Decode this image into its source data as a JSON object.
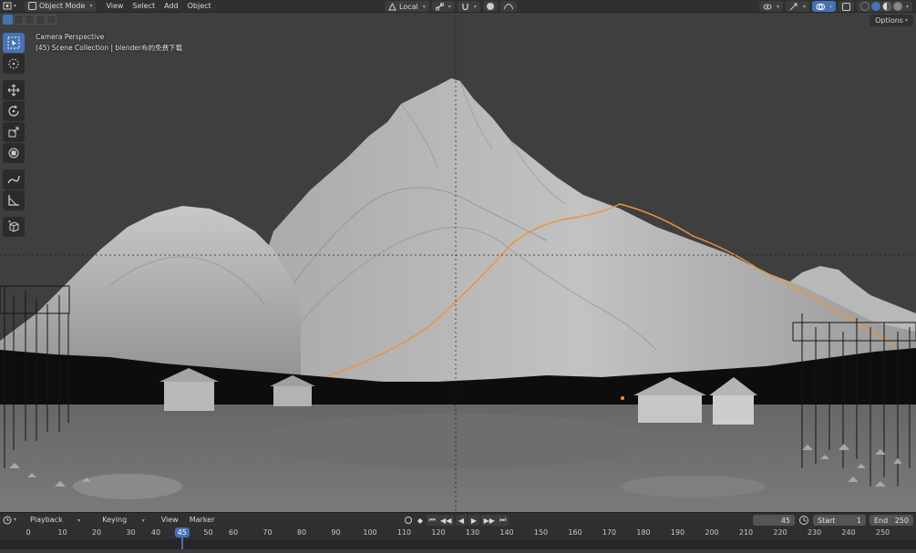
{
  "header": {
    "editor_icon": "viewport-icon",
    "mode": "Object Mode",
    "menus": [
      "View",
      "Select",
      "Add",
      "Object"
    ],
    "transform_orientation": "Local",
    "options_label": "Options"
  },
  "viewport": {
    "overlay_line1": "Camera Perspective",
    "overlay_line2": "(45) Scene Collection | blender布的免费下载"
  },
  "toolbar": {
    "tools": [
      "select-box-icon",
      "cursor-icon",
      "move-icon",
      "rotate-icon",
      "scale-icon",
      "transform-icon",
      "annotate-icon",
      "measure-icon",
      "add-cube-icon"
    ]
  },
  "timeline": {
    "menus": [
      "Playback",
      "Keying",
      "View",
      "Marker"
    ],
    "current_frame": "45",
    "start_label": "Start",
    "start_value": "1",
    "end_label": "End",
    "end_value": "250",
    "ticks": [
      "0",
      "10",
      "20",
      "30",
      "40",
      "50",
      "60",
      "70",
      "80",
      "90",
      "100",
      "110",
      "120",
      "130",
      "140",
      "150",
      "160",
      "170",
      "180",
      "190",
      "200",
      "210",
      "220",
      "230",
      "240",
      "250"
    ],
    "cursor_frame": "45"
  },
  "colors": {
    "accent": "#4772b3",
    "header": "#303030",
    "selection_outline": "#e8953a"
  }
}
